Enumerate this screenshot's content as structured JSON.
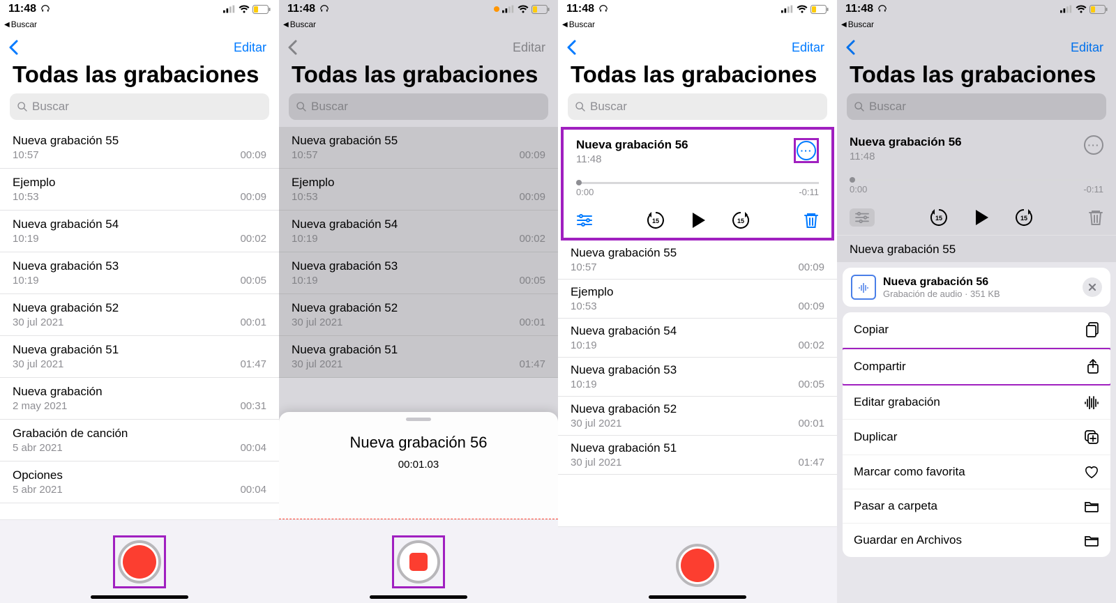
{
  "status_time": "11:48",
  "breadcrumb_back": "Buscar",
  "nav_edit": "Editar",
  "page_title": "Todas las grabaciones",
  "search_placeholder": "Buscar",
  "recordings": [
    {
      "title": "Nueva grabación 55",
      "sub": "10:57",
      "dur": "00:09"
    },
    {
      "title": "Ejemplo",
      "sub": "10:53",
      "dur": "00:09"
    },
    {
      "title": "Nueva grabación 54",
      "sub": "10:19",
      "dur": "00:02"
    },
    {
      "title": "Nueva grabación 53",
      "sub": "10:19",
      "dur": "00:05"
    },
    {
      "title": "Nueva grabación 52",
      "sub": "30 jul 2021",
      "dur": "00:01"
    },
    {
      "title": "Nueva grabación 51",
      "sub": "30 jul 2021",
      "dur": "01:47"
    },
    {
      "title": "Nueva grabación",
      "sub": "2 may 2021",
      "dur": "00:31"
    },
    {
      "title": "Grabación de canción",
      "sub": "5 abr 2021",
      "dur": "00:04"
    },
    {
      "title": "Opciones",
      "sub": "5 abr 2021",
      "dur": "00:04"
    }
  ],
  "recordings_short": [
    {
      "title": "Nueva grabación 55",
      "sub": "10:57",
      "dur": "00:09"
    },
    {
      "title": "Ejemplo",
      "sub": "10:53",
      "dur": "00:09"
    },
    {
      "title": "Nueva grabación 54",
      "sub": "10:19",
      "dur": "00:02"
    },
    {
      "title": "Nueva grabación 53",
      "sub": "10:19",
      "dur": "00:05"
    },
    {
      "title": "Nueva grabación 52",
      "sub": "30 jul 2021",
      "dur": "00:01"
    },
    {
      "title": "Nueva grabación 51",
      "sub": "30 jul 2021",
      "dur": "01:47"
    }
  ],
  "sheet_title": "Nueva grabación 56",
  "sheet_time": "00:01.03",
  "player": {
    "title": "Nueva grabación 56",
    "sub": "11:48",
    "t_start": "0:00",
    "t_end": "-0:11"
  },
  "below_player": [
    {
      "title": "Nueva grabación 55",
      "sub": "10:57",
      "dur": "00:09"
    },
    {
      "title": "Ejemplo",
      "sub": "10:53",
      "dur": "00:09"
    },
    {
      "title": "Nueva grabación 54",
      "sub": "10:19",
      "dur": "00:02"
    },
    {
      "title": "Nueva grabación 53",
      "sub": "10:19",
      "dur": "00:05"
    },
    {
      "title": "Nueva grabación 52",
      "sub": "30 jul 2021",
      "dur": "00:01"
    },
    {
      "title": "Nueva grabación 51",
      "sub": "30 jul 2021",
      "dur": "01:47"
    }
  ],
  "screen4_visible_row": {
    "title": "Nueva grabación 55"
  },
  "context_card": {
    "title": "Nueva grabación 56",
    "sub": "Grabación de audio · 351 KB"
  },
  "menu_items": [
    "Copiar",
    "Compartir",
    "Editar grabación",
    "Duplicar",
    "Marcar como favorita",
    "Pasar a carpeta",
    "Guardar en Archivos"
  ]
}
